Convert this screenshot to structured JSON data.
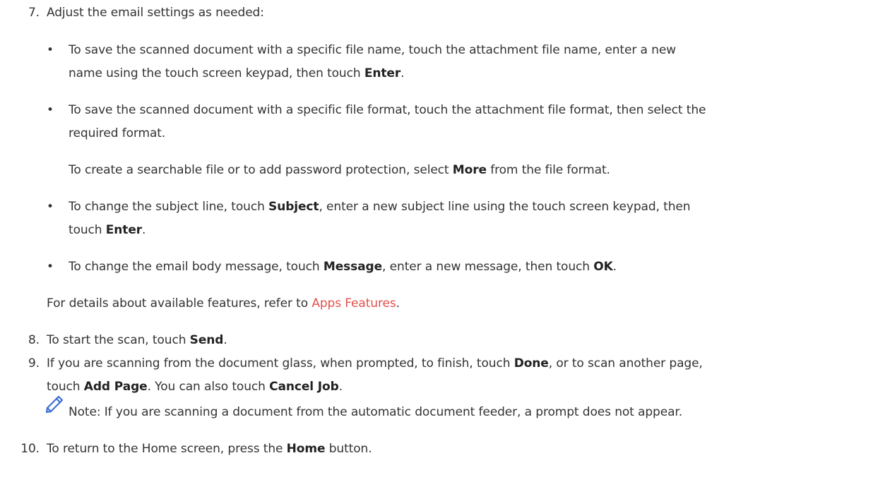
{
  "steps": {
    "s7": {
      "number": "7.",
      "text": "Adjust the email settings as needed:",
      "bullets": {
        "b1": {
          "line1": "To save the scanned document with a specific file name, touch the attachment file name, enter a new",
          "line2_pre": "name using the touch screen keypad, then touch ",
          "line2_b1": "Enter",
          "line2_post": "."
        },
        "b2": {
          "line1": "To save the scanned document with a specific file format, touch the attachment file format, then select the",
          "line2": "required format.",
          "sub_pre": "To create a searchable file or to add password protection, select ",
          "sub_b1": "More",
          "sub_post": " from the file format."
        },
        "b3": {
          "line1_pre": "To change the subject line, touch ",
          "line1_b1": "Subject",
          "line1_post": ", enter a new subject line using the touch screen keypad, then",
          "line2_pre": "touch ",
          "line2_b1": "Enter",
          "line2_post": "."
        },
        "b4": {
          "pre": "To change the email body message, touch ",
          "b1": "Message",
          "mid": ", enter a new message, then touch ",
          "b2": "OK",
          "post": "."
        }
      },
      "details_pre": "For details about available features, refer to ",
      "details_link": "Apps Features",
      "details_post": "."
    },
    "s8": {
      "number": "8.",
      "pre": "To start the scan, touch ",
      "b1": "Send",
      "post": "."
    },
    "s9": {
      "number": "9.",
      "line1_pre": "If you are scanning from the document glass, when prompted, to finish, touch ",
      "line1_b1": "Done",
      "line1_post": ", or to scan another page,",
      "line2_pre": "touch ",
      "line2_b1": "Add Page",
      "line2_mid": ". You can also touch ",
      "line2_b2": "Cancel Job",
      "line2_post": "."
    },
    "note": {
      "icon": "pencil-icon",
      "text": "Note: If you are scanning a document from the automatic document feeder, a prompt does not appear."
    },
    "s10": {
      "number": "10.",
      "pre": "To return to the Home screen, press the ",
      "b1": "Home",
      "post": " button."
    }
  },
  "colors": {
    "text": "#333333",
    "link": "#e0514b",
    "icon": "#3c6fd6"
  }
}
